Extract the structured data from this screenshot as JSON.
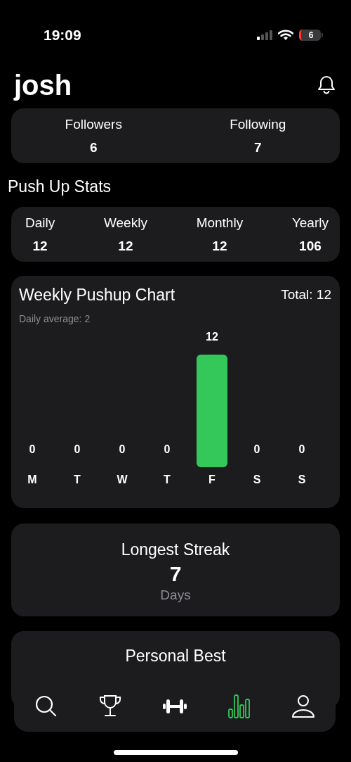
{
  "status_bar": {
    "time": "19:09",
    "battery": "6"
  },
  "profile": {
    "name": "josh"
  },
  "social": [
    {
      "label": "Followers",
      "value": "6"
    },
    {
      "label": "Following",
      "value": "7"
    }
  ],
  "section_title": "Push Up Stats",
  "stats": [
    {
      "label": "Daily",
      "value": "12"
    },
    {
      "label": "Weekly",
      "value": "12"
    },
    {
      "label": "Monthly",
      "value": "12"
    },
    {
      "label": "Yearly",
      "value": "106"
    }
  ],
  "weekly_chart": {
    "title": "Weekly Pushup Chart",
    "total": "Total: 12",
    "average": "Daily average: 2",
    "chart_data": {
      "type": "bar",
      "categories": [
        "M",
        "T",
        "W",
        "T",
        "F",
        "S",
        "S"
      ],
      "series": [
        {
          "color": "#34c759",
          "values": [
            0,
            0,
            0,
            0,
            12,
            0,
            0
          ]
        }
      ],
      "data_labels": true
    }
  },
  "streak": {
    "title": "Longest Streak",
    "value": "7",
    "unit": "Days"
  },
  "personal_best": {
    "title": "Personal Best"
  },
  "tab_bar": [
    {
      "selected": false
    },
    {
      "selected": false
    },
    {
      "selected": false
    },
    {
      "selected": true
    },
    {
      "selected": false
    }
  ]
}
